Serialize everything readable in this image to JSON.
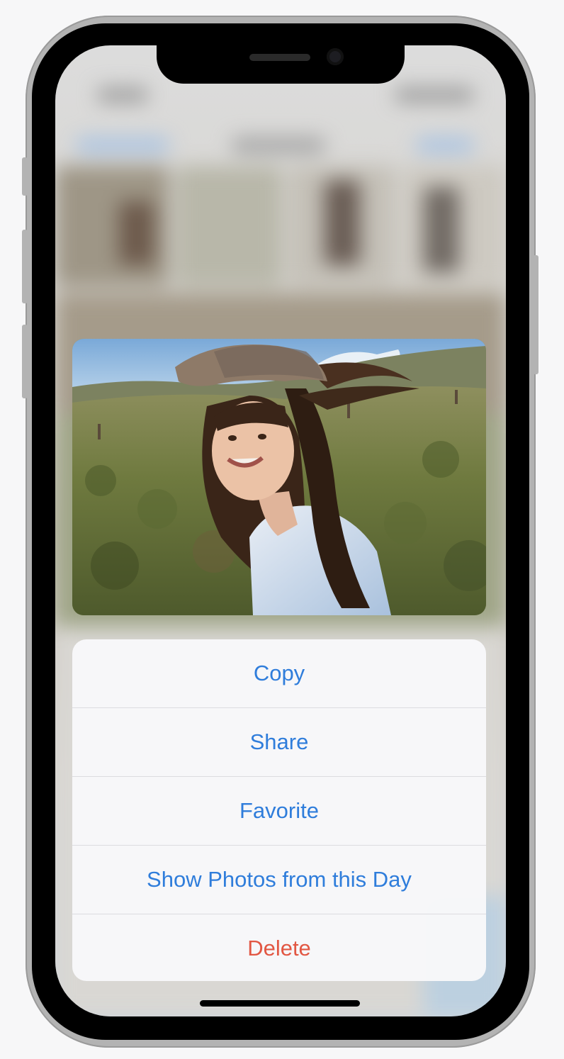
{
  "context_menu": {
    "items": [
      {
        "label": "Copy",
        "role": "normal"
      },
      {
        "label": "Share",
        "role": "normal"
      },
      {
        "label": "Favorite",
        "role": "normal"
      },
      {
        "label": "Show Photos from this Day",
        "role": "normal"
      },
      {
        "label": "Delete",
        "role": "destructive"
      }
    ]
  },
  "preview": {
    "subject": "photo-preview"
  },
  "colors": {
    "accent": "#2f7ddb",
    "destructive": "#e25743",
    "menu_background": "#f8f8fa",
    "device_frame": "#b3b3b3"
  }
}
